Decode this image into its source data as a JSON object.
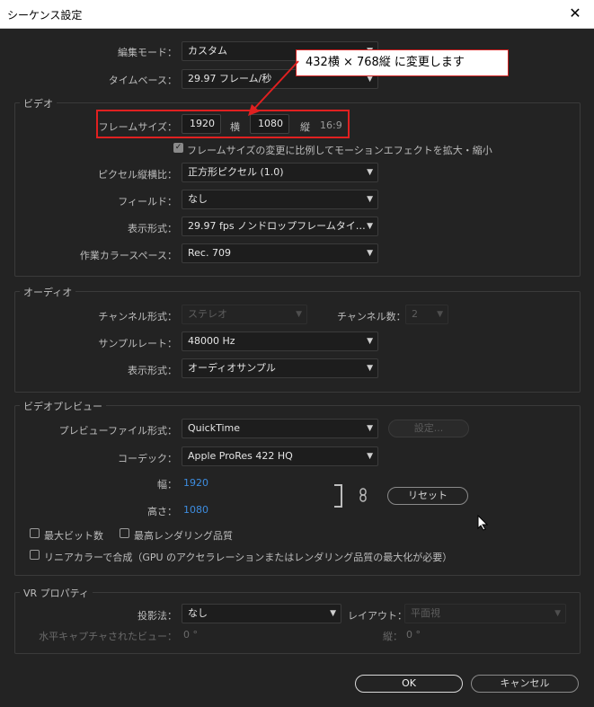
{
  "window": {
    "title": "シーケンス設定"
  },
  "general": {
    "edit_mode_label": "編集モード：",
    "edit_mode_value": "カスタム",
    "timebase_label": "タイムベース：",
    "timebase_value": "29.97  フレーム/秒"
  },
  "annotation": {
    "callout_text": "432横 × 768縦 に変更します",
    "highlight_color": "#e02020"
  },
  "video": {
    "section_title": "ビデオ",
    "frame_size_label": "フレームサイズ：",
    "width": "1920",
    "width_unit": "横",
    "height": "1080",
    "height_unit": "縦",
    "aspect": "16:9",
    "scale_checkbox_label": "フレームサイズの変更に比例してモーションエフェクトを拡大・縮小",
    "scale_checked": true,
    "pixel_aspect_label": "ピクセル縦横比：",
    "pixel_aspect_value": "正方形ピクセル (1.0)",
    "field_label": "フィールド：",
    "field_value": "なし",
    "display_format_label": "表示形式：",
    "display_format_value": "29.97  fps ノンドロップフレームタイ…",
    "color_space_label": "作業カラースペース：",
    "color_space_value": "Rec. 709"
  },
  "audio": {
    "section_title": "オーディオ",
    "channel_format_label": "チャンネル形式：",
    "channel_format_value": "ステレオ",
    "channel_count_label": "チャンネル数：",
    "channel_count_value": "2",
    "sample_rate_label": "サンプルレート：",
    "sample_rate_value": "48000 Hz",
    "display_format_label": "表示形式：",
    "display_format_value": "オーディオサンプル"
  },
  "preview": {
    "section_title": "ビデオプレビュー",
    "file_format_label": "プレビューファイル形式：",
    "file_format_value": "QuickTime",
    "settings_button": "設定...",
    "codec_label": "コーデック：",
    "codec_value": "Apple ProRes 422 HQ",
    "width_label": "幅：",
    "width_value": "1920",
    "height_label": "高さ：",
    "height_value": "1080",
    "reset_button": "リセット",
    "max_bit_depth_label": "最大ビット数",
    "max_render_quality_label": "最高レンダリング品質",
    "linear_color_label": "リニアカラーで合成（GPU のアクセラレーションまたはレンダリング品質の最大化が必要）"
  },
  "vr": {
    "section_title": "VR プロパティ",
    "projection_label": "投影法：",
    "projection_value": "なし",
    "layout_label": "レイアウト：",
    "layout_value": "平面視",
    "horizontal_label": "水平キャプチャされたビュー：",
    "horizontal_value": "0 °",
    "vertical_label": "縦：",
    "vertical_value": "0 °"
  },
  "footer": {
    "ok_button": "OK",
    "cancel_button": "キャンセル"
  }
}
